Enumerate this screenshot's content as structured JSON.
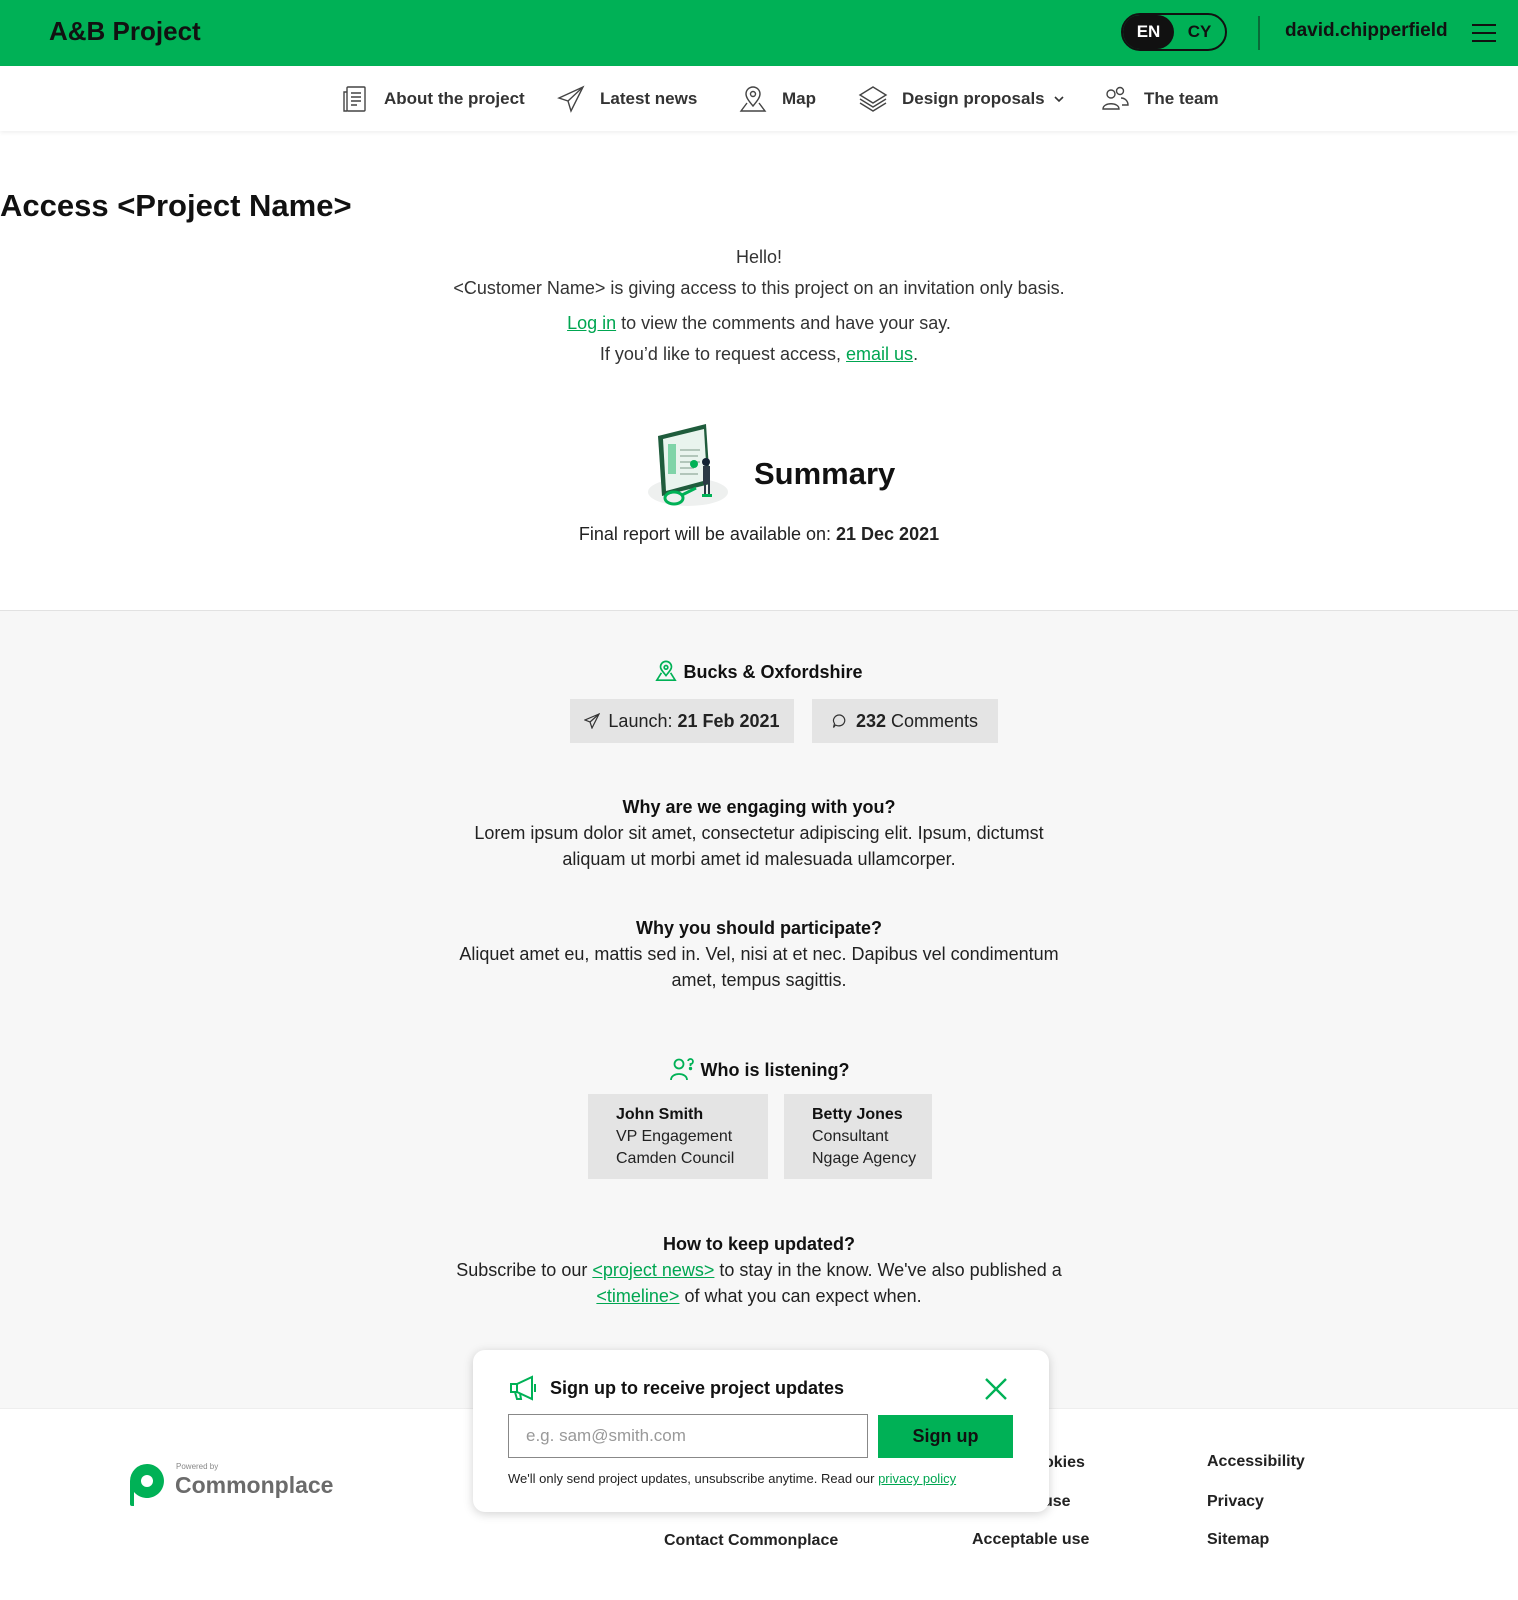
{
  "header": {
    "brand": "A&B Project",
    "lang_active": "EN",
    "lang_other": "CY",
    "username": "david.chipperfield",
    "accent_color": "#00b156"
  },
  "nav": {
    "items": [
      {
        "label": "About the project",
        "icon": "document-icon"
      },
      {
        "label": "Latest news",
        "icon": "paper-plane-icon"
      },
      {
        "label": "Map",
        "icon": "map-pin-icon"
      },
      {
        "label": "Design proposals",
        "icon": "layers-icon"
      },
      {
        "label": "The team",
        "icon": "people-icon"
      }
    ]
  },
  "hero": {
    "title": "Access <Project Name>",
    "greeting": "Hello!",
    "intro": "<Customer Name> is giving access to this project on an invitation only basis.",
    "login_link": "Log in",
    "login_rest": " to view the comments and have your say.",
    "request_prefix": "If you’d like to request access, ",
    "email_link": "email us",
    "request_suffix": "."
  },
  "summary": {
    "title": "Summary",
    "final_prefix": "Final report will be available on: ",
    "final_date": "21 Dec 2021"
  },
  "details": {
    "location": "Bucks & Oxfordshire",
    "launch_label": "Launch: ",
    "launch_date": "21 Feb 2021",
    "comments_count": "232",
    "comments_label": " Comments"
  },
  "sections": {
    "why_engaging_title": "Why are we engaging with you?",
    "why_engaging_body": "Lorem ipsum dolor sit amet, consectetur adipiscing elit. Ipsum, dictumst aliquam ut morbi amet id malesuada ullamcorper.",
    "why_participate_title": "Why you should participate?",
    "why_participate_body": "Aliquet amet eu, mattis sed in. Vel, nisi at et nec. Dapibus vel condimentum amet, tempus sagittis.",
    "listening_title": "Who is listening?",
    "updated_title": "How to keep updated?",
    "updated_prefix": "Subscribe to our ",
    "updated_link1": "<project news>",
    "updated_mid": " to stay in the know. We've also published a ",
    "updated_link2": "<timeline>",
    "updated_suffix": " of what you can expect when."
  },
  "people": [
    {
      "name": "John Smith",
      "role": "VP Engagement",
      "org": "Camden Council"
    },
    {
      "name": "Betty Jones",
      "role": "Consultant",
      "org": "Ngage Agency"
    }
  ],
  "footer": {
    "powered_by": "Powered by",
    "logo_text": "Commonplace",
    "links": [
      "Contact Commonplace",
      "okies",
      "use",
      "Acceptable use",
      "Accessibility",
      "Privacy",
      "Sitemap"
    ]
  },
  "popup": {
    "title": "Sign up to receive project updates",
    "input_placeholder": "e.g. sam@smith.com",
    "button_label": "Sign up",
    "note_prefix": "We'll only send project updates, unsubscribe anytime. Read our ",
    "note_link": "privacy policy"
  }
}
